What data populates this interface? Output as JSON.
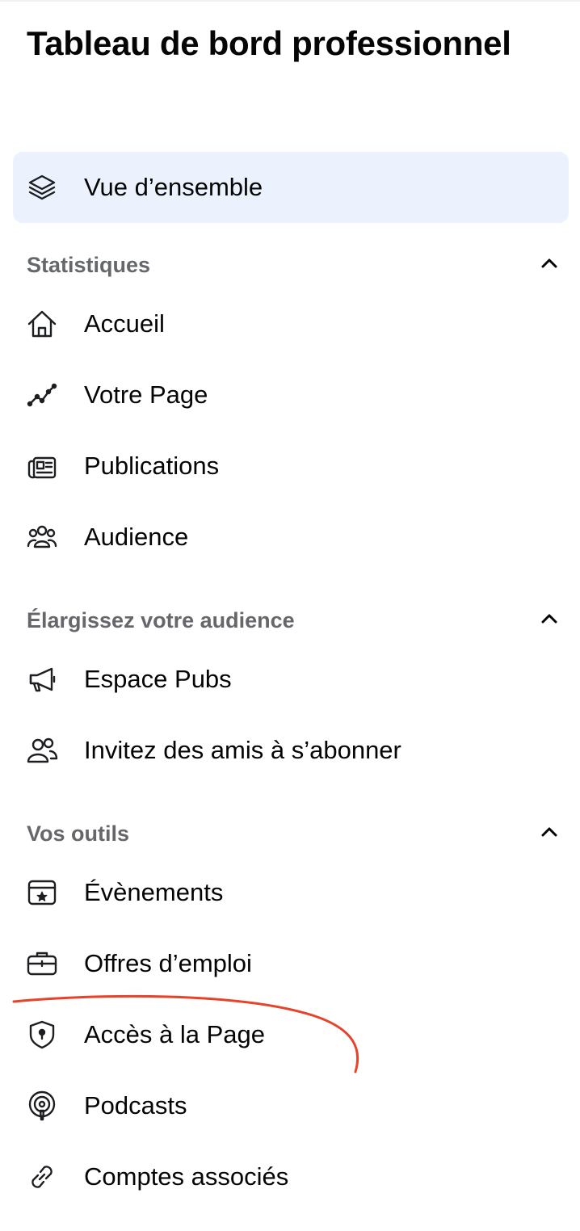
{
  "page": {
    "title": "Tableau de bord professionnel"
  },
  "overview": {
    "label": "Vue d’ensemble",
    "icon": "layers-icon",
    "highlight_color": "#ebf2fd"
  },
  "sections": {
    "stats": {
      "label": "Statistiques",
      "icon": "chevron-up-icon"
    },
    "grow": {
      "label": "Élargissez votre audience",
      "icon": "chevron-up-icon"
    },
    "tools": {
      "label": "Vos outils",
      "icon": "chevron-up-icon"
    }
  },
  "items": {
    "home": {
      "label": "Accueil",
      "icon": "home-icon"
    },
    "page": {
      "label": "Votre Page",
      "icon": "line-chart-icon"
    },
    "posts": {
      "label": "Publications",
      "icon": "newspaper-icon"
    },
    "audience": {
      "label": "Audience",
      "icon": "group-icon"
    },
    "ads": {
      "label": "Espace Pubs",
      "icon": "megaphone-icon"
    },
    "invite": {
      "label": "Invitez des amis à s’abonner",
      "icon": "users-icon"
    },
    "events": {
      "label": "Évènements",
      "icon": "calendar-star-icon"
    },
    "jobs": {
      "label": "Offres d’emploi",
      "icon": "briefcase-icon"
    },
    "access": {
      "label": "Accès à la Page",
      "icon": "shield-lock-icon"
    },
    "podcasts": {
      "label": "Podcasts",
      "icon": "podcast-icon"
    },
    "linked": {
      "label": "Comptes associés",
      "icon": "link-icon"
    }
  },
  "annotation": {
    "color": "#e8432a"
  }
}
